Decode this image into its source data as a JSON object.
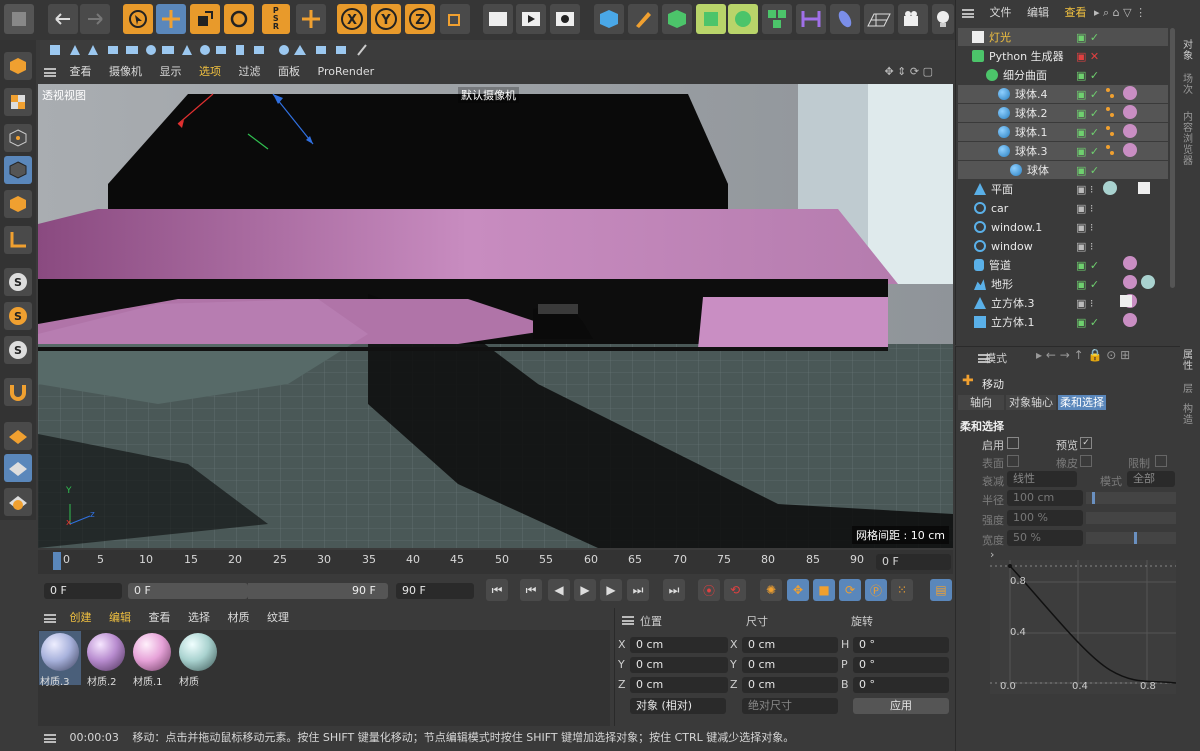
{
  "top_menu": {
    "file": "文件",
    "edit": "编辑",
    "view": "查看"
  },
  "viewport_menu": [
    "查看",
    "摄像机",
    "显示",
    "选项",
    "过滤",
    "面板",
    "ProRender"
  ],
  "viewport": {
    "name": "透视视图",
    "camera": "默认摄像机",
    "grid": "网格间距 : 10 cm"
  },
  "objects": [
    {
      "name": "灯光",
      "label": "灯光"
    },
    {
      "name": "python",
      "label": "Python 生成器"
    },
    {
      "name": "subdiv",
      "label": "细分曲面"
    },
    {
      "name": "sphere4",
      "label": "球体.4"
    },
    {
      "name": "sphere2",
      "label": "球体.2"
    },
    {
      "name": "sphere1",
      "label": "球体.1"
    },
    {
      "name": "sphere3",
      "label": "球体.3"
    },
    {
      "name": "sphere",
      "label": "球体"
    },
    {
      "name": "plane",
      "label": "平面"
    },
    {
      "name": "car",
      "label": "car"
    },
    {
      "name": "window1",
      "label": "window.1"
    },
    {
      "name": "window",
      "label": "window"
    },
    {
      "name": "pipe",
      "label": "管道"
    },
    {
      "name": "terrain",
      "label": "地形"
    },
    {
      "name": "cube3",
      "label": "立方体.3"
    },
    {
      "name": "cube1",
      "label": "立方体.1"
    }
  ],
  "side_tabs": {
    "objects": "对象",
    "scene": "场次",
    "content": "内容浏览器",
    "attributes": "属性",
    "layers": "层",
    "structure": "构造"
  },
  "attrs": {
    "mode": "模式",
    "tool": "移动",
    "tabs": [
      "轴向",
      "对象轴心",
      "柔和选择"
    ],
    "section": "柔和选择",
    "enable": "启用",
    "preview": "预览",
    "surface": "表面",
    "rubber": "橡皮",
    "limit": "限制",
    "falloff": "衰减",
    "falloff_val": "线性",
    "mode2": "模式",
    "mode2_val": "全部",
    "radius": "半径",
    "radius_val": "100 cm",
    "strength": "强度",
    "strength_val": "100 %",
    "width": "宽度",
    "width_val": "50 %",
    "graph_y": [
      "0.8",
      "0.4",
      "0.0"
    ],
    "graph_x": [
      "0.4",
      "0.8"
    ]
  },
  "timeline": {
    "ticks": [
      "0",
      "5",
      "10",
      "15",
      "20",
      "25",
      "30",
      "35",
      "40",
      "45",
      "50",
      "55",
      "60",
      "65",
      "70",
      "75",
      "80",
      "85",
      "90"
    ],
    "current": "0 F",
    "start": "0 F",
    "range_start": "0 F",
    "range_end": "90 F",
    "end": "90 F"
  },
  "materials": {
    "menu": [
      "创建",
      "编辑",
      "查看",
      "选择",
      "材质",
      "纹理"
    ],
    "items": [
      {
        "label": "材质.3",
        "color": "#a8b2dc"
      },
      {
        "label": "材质.2",
        "color": "#b88ccf"
      },
      {
        "label": "材质.1",
        "color": "#e6a2d8"
      },
      {
        "label": "材质",
        "color": "#a9d2cf"
      }
    ]
  },
  "coords": {
    "headers": [
      "位置",
      "尺寸",
      "旋转"
    ],
    "rows": [
      {
        "a": "X",
        "av": "0 cm",
        "b": "X",
        "bv": "0 cm",
        "c": "H",
        "cv": "0 °"
      },
      {
        "a": "Y",
        "av": "0 cm",
        "b": "Y",
        "bv": "0 cm",
        "c": "P",
        "cv": "0 °"
      },
      {
        "a": "Z",
        "av": "0 cm",
        "b": "Z",
        "bv": "0 cm",
        "c": "B",
        "cv": "0 °"
      }
    ],
    "object_mode": "对象 (相对)",
    "size_mode": "绝对尺寸",
    "apply": "应用"
  },
  "status": {
    "time": "00:00:03",
    "message": "移动：点击并拖动鼠标移动元素。按住 SHIFT 键量化移动；节点编辑模式时按住 SHIFT 键增加选择对象；按住 CTRL 键减少选择对象。"
  }
}
